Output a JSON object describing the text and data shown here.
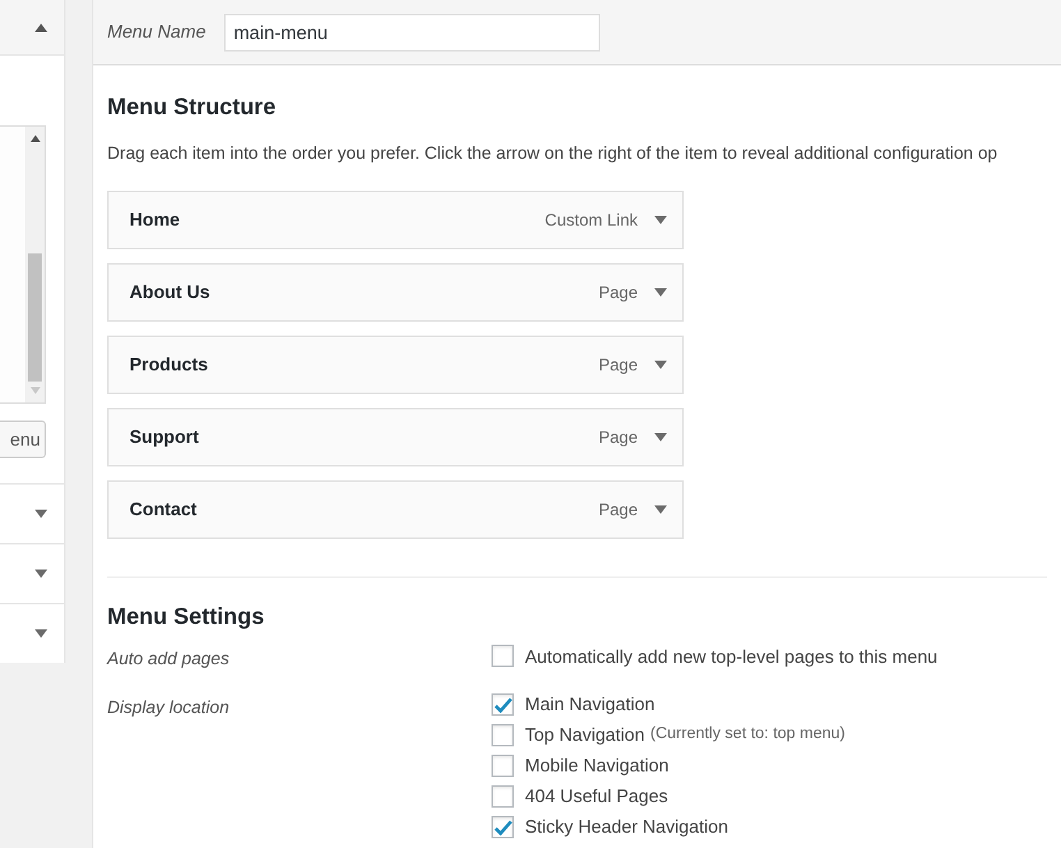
{
  "sidebar": {
    "button_label": "enu",
    "sections": [
      {
        "expanded": true
      },
      {
        "expanded": false
      },
      {
        "expanded": false
      },
      {
        "expanded": false
      }
    ]
  },
  "menu_name": {
    "label": "Menu Name",
    "value": "main-menu"
  },
  "structure": {
    "title": "Menu Structure",
    "description": "Drag each item into the order you prefer. Click the arrow on the right of the item to reveal additional configuration op",
    "items": [
      {
        "title": "Home",
        "type": "Custom Link"
      },
      {
        "title": "About Us",
        "type": "Page"
      },
      {
        "title": "Products",
        "type": "Page"
      },
      {
        "title": "Support",
        "type": "Page"
      },
      {
        "title": "Contact",
        "type": "Page"
      }
    ]
  },
  "settings": {
    "title": "Menu Settings",
    "groups": [
      {
        "label": "Auto add pages",
        "options": [
          {
            "label": "Automatically add new top-level pages to this menu",
            "checked": false
          }
        ]
      },
      {
        "label": "Display location",
        "options": [
          {
            "label": "Main Navigation",
            "checked": true
          },
          {
            "label": "Top Navigation",
            "note": "(Currently set to: top menu)",
            "checked": false
          },
          {
            "label": "Mobile Navigation",
            "checked": false
          },
          {
            "label": "404 Useful Pages",
            "checked": false
          },
          {
            "label": "Sticky Header Navigation",
            "checked": true
          }
        ]
      }
    ]
  }
}
